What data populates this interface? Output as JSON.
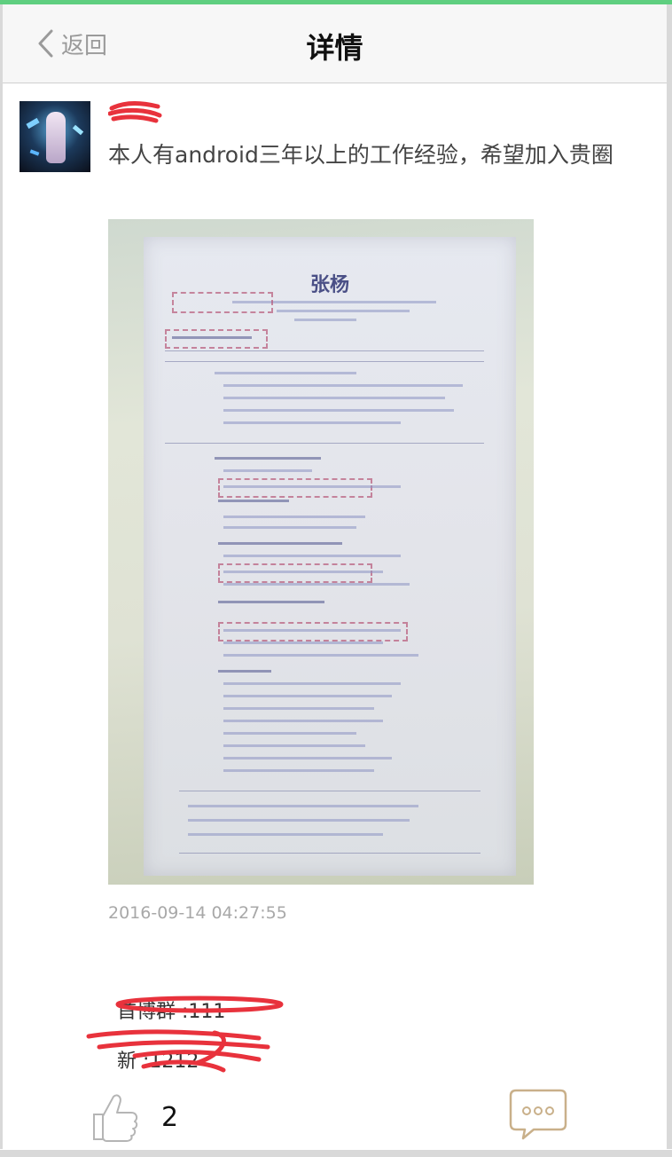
{
  "navbar": {
    "back_label": "返回",
    "title": "详情"
  },
  "post": {
    "author_redacted": "",
    "text": "本人有android三年以上的工作经验，希望加入贵圈",
    "image_doc_title": "张杨",
    "timestamp": "2016-09-14 04:27:55"
  },
  "comments": [
    {
      "text": "首博群 :111"
    },
    {
      "text": "新      :1212"
    }
  ],
  "actions": {
    "like_count": "2"
  },
  "colors": {
    "accent": "#5fcf80",
    "redaction": "#e8323c"
  },
  "icons": {
    "back": "chevron-left-icon",
    "like": "thumbs-up-icon",
    "comment": "comment-bubble-icon"
  }
}
